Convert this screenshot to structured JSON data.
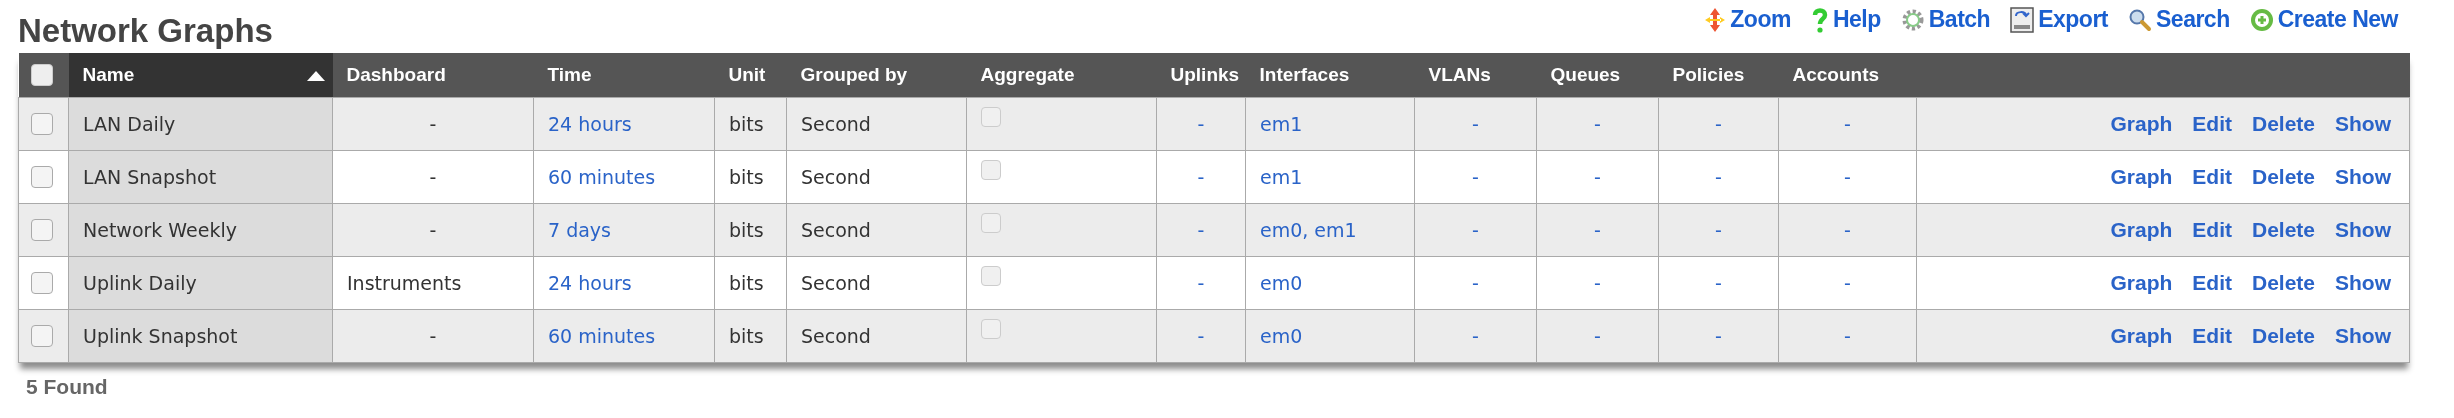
{
  "title": "Network Graphs",
  "toolbar": [
    {
      "kind": "zoom",
      "label": "Zoom"
    },
    {
      "kind": "help",
      "label": "Help"
    },
    {
      "kind": "batch",
      "label": "Batch"
    },
    {
      "kind": "export",
      "label": "Export"
    },
    {
      "kind": "search",
      "label": "Search"
    },
    {
      "kind": "create",
      "label": "Create New"
    }
  ],
  "table": {
    "select_all": {
      "checked": false
    },
    "columns": [
      {
        "label": "Name",
        "kind": "name",
        "sorted": true
      },
      {
        "label": "Dashboard",
        "kind": "text",
        "sorted": false
      },
      {
        "label": "Time",
        "kind": "link",
        "sorted": false
      },
      {
        "label": "Unit",
        "kind": "text",
        "sorted": false
      },
      {
        "label": "Grouped by",
        "kind": "text",
        "sorted": false
      },
      {
        "label": "Aggregate",
        "kind": "check",
        "sorted": false
      },
      {
        "label": "Uplinks",
        "kind": "link",
        "sorted": false
      },
      {
        "label": "Interfaces",
        "kind": "link",
        "sorted": false
      },
      {
        "label": "VLANs",
        "kind": "link",
        "sorted": false
      },
      {
        "label": "Queues",
        "kind": "link",
        "sorted": false
      },
      {
        "label": "Policies",
        "kind": "link",
        "sorted": false
      },
      {
        "label": "Accounts",
        "kind": "link",
        "sorted": false
      }
    ],
    "rows": [
      {
        "checked": false,
        "cells": [
          "LAN Daily",
          "-",
          "24 hours",
          "bits",
          "Second",
          {
            "checked": false
          },
          "-",
          "em1",
          "-",
          "-",
          "-",
          "-"
        ],
        "actions": [
          "Graph",
          "Edit",
          "Delete",
          "Show"
        ]
      },
      {
        "checked": false,
        "cells": [
          "LAN Snapshot",
          "-",
          "60 minutes",
          "bits",
          "Second",
          {
            "checked": false
          },
          "-",
          "em1",
          "-",
          "-",
          "-",
          "-"
        ],
        "actions": [
          "Graph",
          "Edit",
          "Delete",
          "Show"
        ]
      },
      {
        "checked": false,
        "cells": [
          "Network Weekly",
          "-",
          "7 days",
          "bits",
          "Second",
          {
            "checked": false
          },
          "-",
          "em0, em1",
          "-",
          "-",
          "-",
          "-"
        ],
        "actions": [
          "Graph",
          "Edit",
          "Delete",
          "Show"
        ]
      },
      {
        "checked": false,
        "cells": [
          "Uplink Daily",
          "Instruments",
          "24 hours",
          "bits",
          "Second",
          {
            "checked": false
          },
          "-",
          "em0",
          "-",
          "-",
          "-",
          "-"
        ],
        "actions": [
          "Graph",
          "Edit",
          "Delete",
          "Show"
        ]
      },
      {
        "checked": false,
        "cells": [
          "Uplink Snapshot",
          "-",
          "60 minutes",
          "bits",
          "Second",
          {
            "checked": false
          },
          "-",
          "em0",
          "-",
          "-",
          "-",
          "-"
        ],
        "actions": [
          "Graph",
          "Edit",
          "Delete",
          "Show"
        ]
      }
    ]
  },
  "footer": "5 Found"
}
